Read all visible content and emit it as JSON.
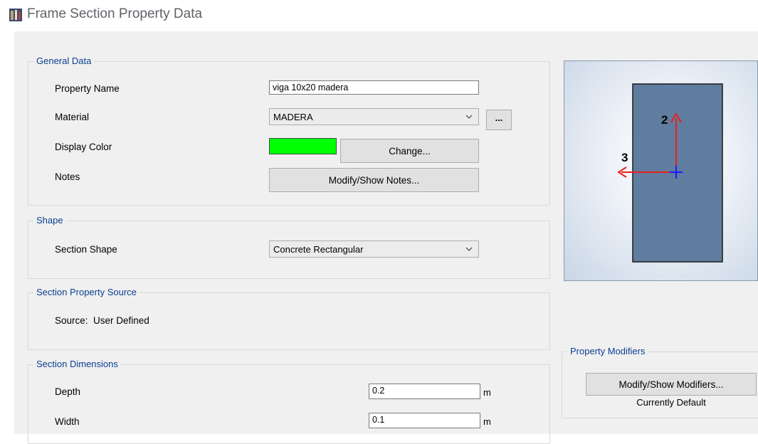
{
  "window": {
    "title": "Frame Section Property Data",
    "icon": "frame-section-icon"
  },
  "general_data": {
    "title": "General Data",
    "property_name": {
      "label": "Property Name",
      "value": "viga 10x20 madera"
    },
    "material": {
      "label": "Material",
      "value": "MADERA",
      "more_button": "..."
    },
    "display_color": {
      "label": "Display Color",
      "color": "#00ff00",
      "change_button": "Change..."
    },
    "notes": {
      "label": "Notes",
      "button": "Modify/Show Notes..."
    }
  },
  "shape": {
    "title": "Shape",
    "section_shape": {
      "label": "Section Shape",
      "value": "Concrete Rectangular"
    }
  },
  "section_property_source": {
    "title": "Section Property Source",
    "source": "Source:  User Defined"
  },
  "section_dimensions": {
    "title": "Section Dimensions",
    "depth": {
      "label": "Depth",
      "value": "0.2",
      "unit": "m"
    },
    "width": {
      "label": "Width",
      "value": "0.1",
      "unit": "m"
    }
  },
  "preview": {
    "axis_2_label": "2",
    "axis_3_label": "3",
    "section_fill": "#5f7d9e",
    "axis_color": "#e8201c",
    "centroid_color": "#1a1aff"
  },
  "property_modifiers": {
    "title": "Property Modifiers",
    "button": "Modify/Show Modifiers...",
    "status": "Currently Default"
  },
  "colors": {
    "group_title": "#0b3f92",
    "dialog_bg": "#f0f0f0"
  }
}
